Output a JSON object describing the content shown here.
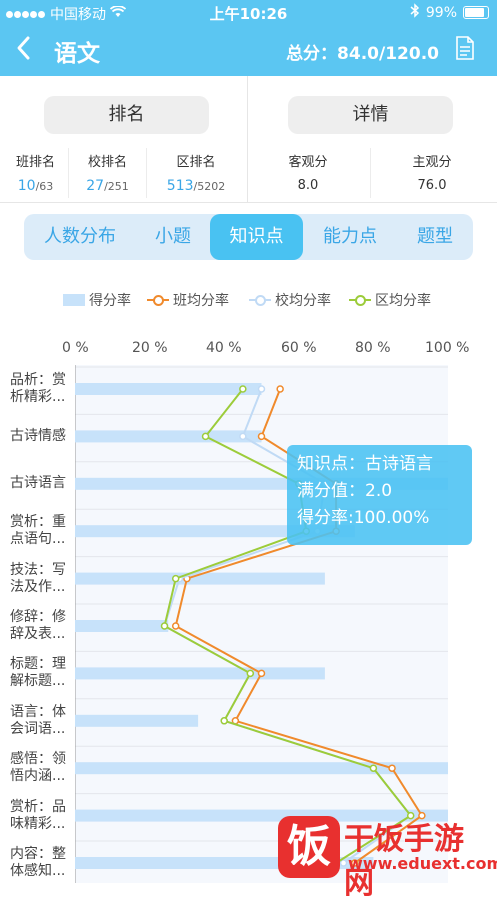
{
  "statusbar": {
    "carrier": "中国移动",
    "time": "上午10:26",
    "battery": "99%"
  },
  "header": {
    "title": "语文",
    "total": "总分：84.0/120.0"
  },
  "left_panel": {
    "button": "排名",
    "stats": [
      {
        "label": "班排名",
        "value": "10",
        "total": "/63"
      },
      {
        "label": "校排名",
        "value": "27",
        "total": "/251"
      },
      {
        "label": "区排名",
        "value": "513",
        "total": "/5202"
      }
    ]
  },
  "right_panel": {
    "button": "详情",
    "stats": [
      {
        "label": "客观分",
        "value": "8.0"
      },
      {
        "label": "主观分",
        "value": "76.0"
      }
    ]
  },
  "tabs": [
    "人数分布",
    "小题",
    "知识点",
    "能力点",
    "题型"
  ],
  "active_tab": 2,
  "chart_data": {
    "type": "bar",
    "orientation": "horizontal",
    "x_ticks": [
      "0 %",
      "20 %",
      "40 %",
      "60 %",
      "80 %",
      "100 %"
    ],
    "xlim": [
      0,
      100
    ],
    "categories": [
      [
        "品析：赏",
        "析精彩..."
      ],
      [
        "古诗情感"
      ],
      [
        "古诗语言"
      ],
      [
        "赏析：重",
        "点语句..."
      ],
      [
        "技法：写",
        "法及作..."
      ],
      [
        "修辞：修",
        "辞及表..."
      ],
      [
        "标题：理",
        "解标题..."
      ],
      [
        "语言：体",
        "会词语..."
      ],
      [
        "感悟：领",
        "悟内涵..."
      ],
      [
        "赏析：品",
        "味精彩..."
      ],
      [
        "内容：整",
        "体感知..."
      ]
    ],
    "series": [
      {
        "name": "得分率",
        "type": "bar",
        "color": "#c7e2fa",
        "values": [
          50,
          50,
          100,
          75,
          67,
          25,
          67,
          33,
          100,
          100,
          80
        ]
      },
      {
        "name": "班均分率",
        "type": "line",
        "color": "#f08a2c",
        "values": [
          55,
          50,
          70,
          70,
          30,
          27,
          50,
          43,
          85,
          93,
          75
        ]
      },
      {
        "name": "校均分率",
        "type": "line",
        "color": "#c0daf5",
        "values": [
          50,
          45,
          67,
          65,
          28,
          24,
          47,
          40,
          80,
          90,
          72
        ]
      },
      {
        "name": "区均分率",
        "type": "line",
        "color": "#9ccc3a",
        "values": [
          45,
          35,
          60,
          62,
          27,
          24,
          47,
          40,
          80,
          90,
          70
        ]
      }
    ],
    "tooltip": {
      "line1": "知识点：古诗语言",
      "line2": "满分值：2.0",
      "line3": "得分率:100.00%"
    }
  },
  "watermark": {
    "glyph": "饭",
    "title": "干饭手游网",
    "url": "www.eduext.com"
  }
}
